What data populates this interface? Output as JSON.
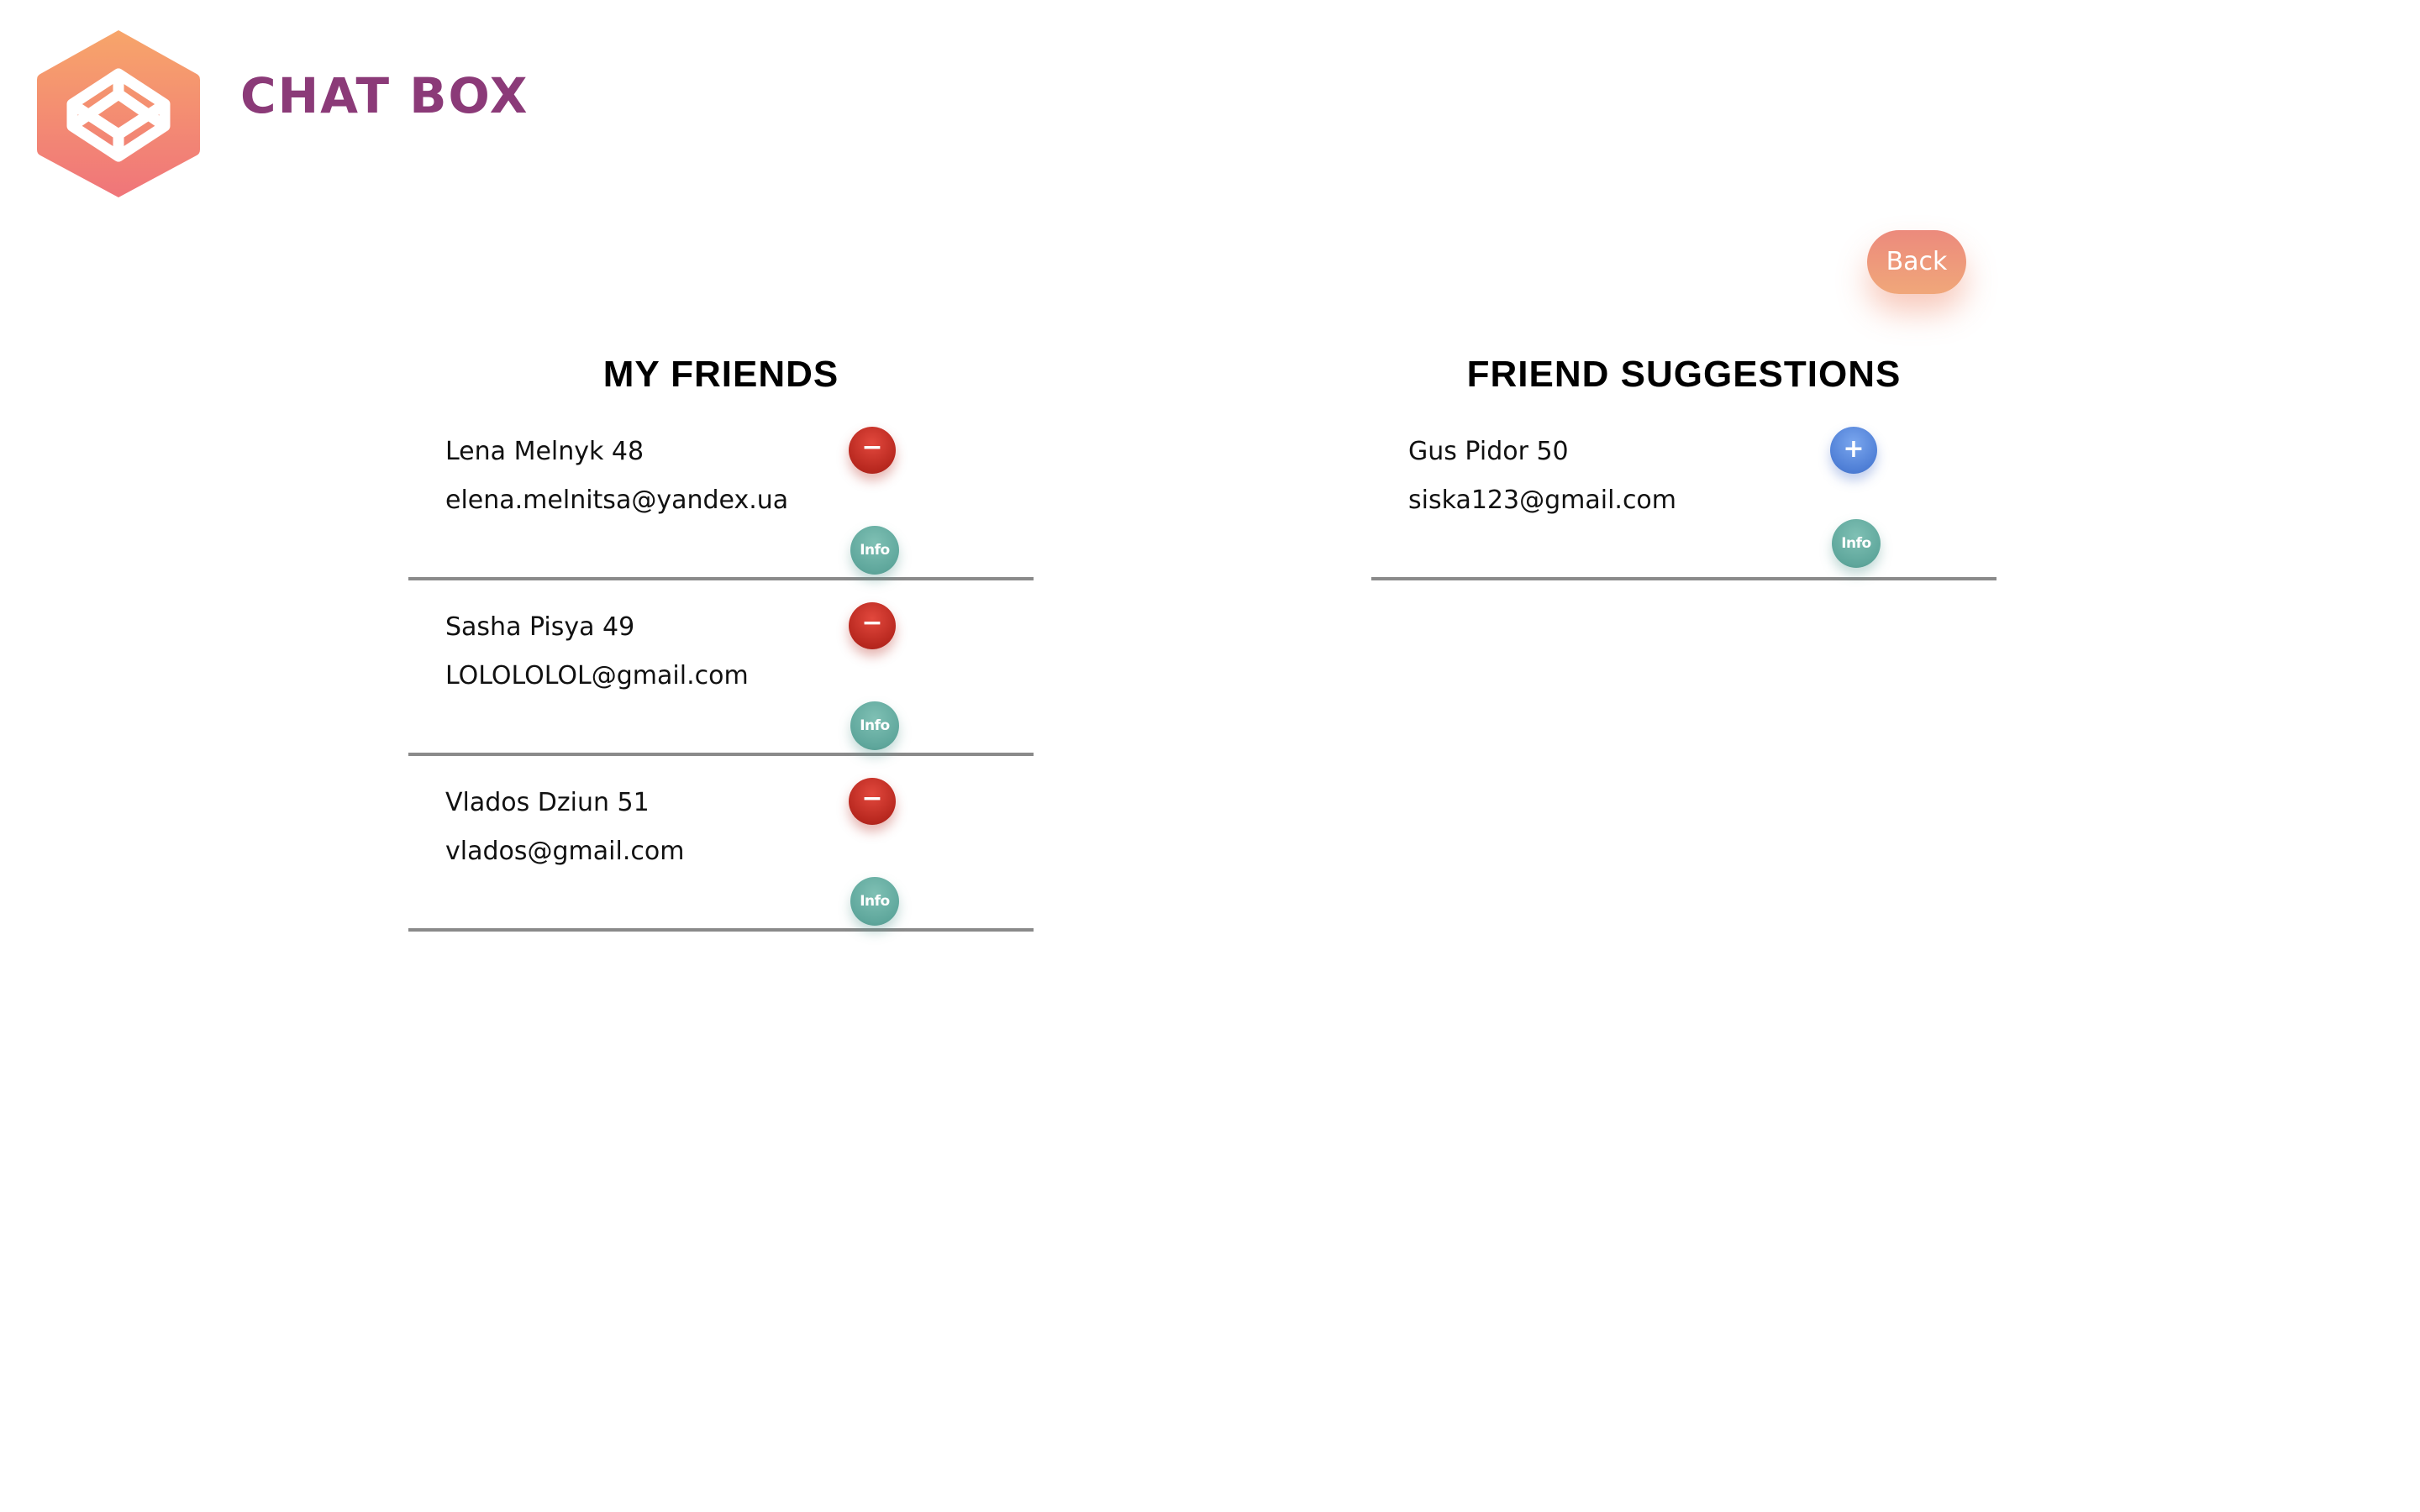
{
  "header": {
    "brand_name": "CHAT BOX",
    "logo_icon": "codepen-hexagon-logo",
    "brand_color": "#8b3a78",
    "logo_gradient": [
      "#f6a06a",
      "#f07a7a"
    ]
  },
  "back_button": {
    "label": "Back",
    "color": "#ee9a7b"
  },
  "friends": {
    "title": "MY FRIENDS",
    "remove_label": "−",
    "info_label": "Info",
    "items": [
      {
        "name": "Lena Melnyk 48",
        "email": "elena.melnitsa@yandex.ua"
      },
      {
        "name": "Sasha Pisya 49",
        "email": "LOLOLOLOL@gmail.com"
      },
      {
        "name": "Vlados Dziun 51",
        "email": "vlados@gmail.com"
      }
    ]
  },
  "suggestions": {
    "title": "FRIEND SUGGESTIONS",
    "add_label": "+",
    "info_label": "Info",
    "items": [
      {
        "name": "Gus Pidor 50",
        "email": "siska123@gmail.com"
      }
    ]
  },
  "colors": {
    "remove": "#c2302a",
    "add": "#5b8be0",
    "info": "#68ada2",
    "divider": "#8a8a8a"
  }
}
